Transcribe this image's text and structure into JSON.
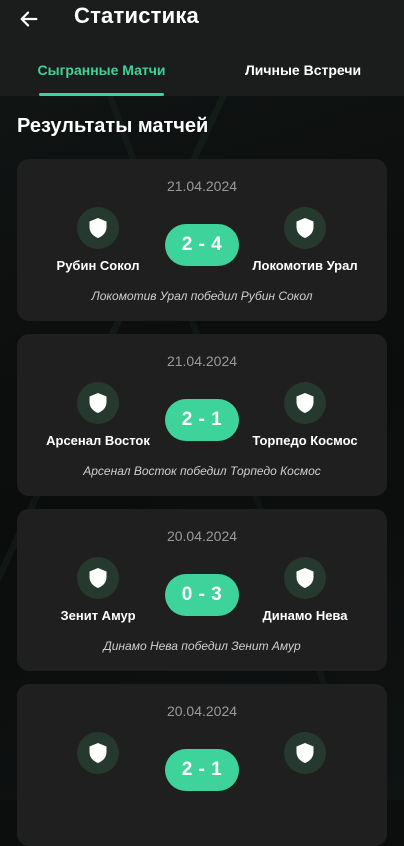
{
  "header": {
    "title": "Статистика",
    "tabs": [
      {
        "label": "Сыгранные Матчи",
        "active": true
      },
      {
        "label": "Личные Встречи",
        "active": false
      }
    ]
  },
  "section_title": "Результаты матчей",
  "colors": {
    "accent": "#3ed39a",
    "card": "#1f1f1f",
    "header": "#1b1c1c"
  },
  "matches": [
    {
      "date": "21.04.2024",
      "home": "Рубин Сокол",
      "away": "Локомотив Урал",
      "score": "2 - 4",
      "result": "Локомотив Урал победил Рубин Сокол"
    },
    {
      "date": "21.04.2024",
      "home": "Арсенал Восток",
      "away": "Торпедо Космос",
      "score": "2 - 1",
      "result": "Арсенал Восток победил Торпедо Космос"
    },
    {
      "date": "20.04.2024",
      "home": "Зенит Амур",
      "away": "Динамо Нева",
      "score": "0 - 3",
      "result": "Динамо Нева победил Зенит Амур"
    },
    {
      "date": "20.04.2024",
      "home": "",
      "away": "",
      "score": "2 - 1",
      "result": ""
    }
  ]
}
